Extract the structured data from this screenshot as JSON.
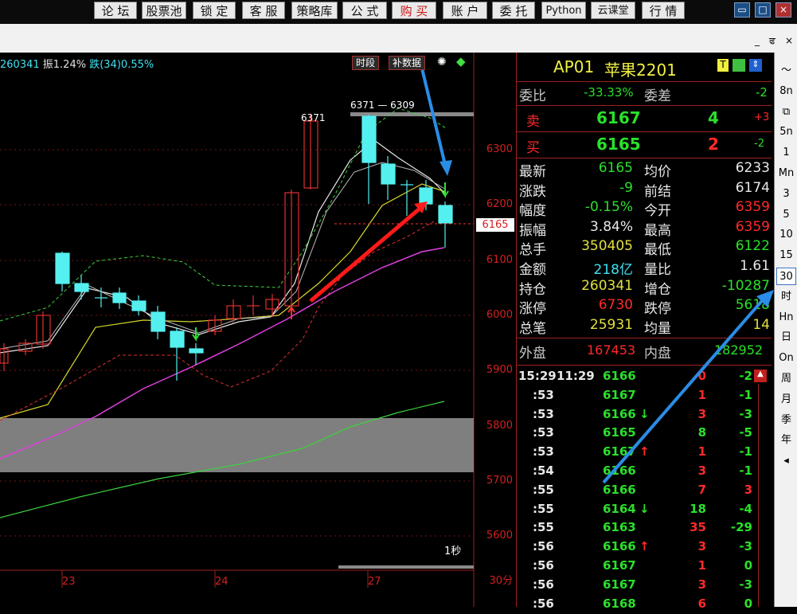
{
  "menu": [
    "论 坛",
    "股票池",
    "锁 定",
    "客 服",
    "策略库",
    "公 式",
    "购 买",
    "账 户",
    "委 托",
    "Python",
    "云课堂",
    "行 情"
  ],
  "window_controls": [
    "▭",
    "□",
    "×"
  ],
  "sub_controls": [
    "_",
    "ਫ",
    "×"
  ],
  "status": {
    "oi": "260341",
    "amp": "振1.24%",
    "fall": "跌(34)0.55%"
  },
  "chart_buttons": {
    "period": "时段",
    "fill": "补数据"
  },
  "yaxis_labels": [
    "6300",
    "6200",
    "6100",
    "6000",
    "5900",
    "5800",
    "5700",
    "5600"
  ],
  "last_price_tag": "6165",
  "xaxis_labels": [
    "23",
    "24",
    "27"
  ],
  "period_label": "30分",
  "refresh_label": "1秒",
  "hi_label": "6371",
  "top_note": "6371 — 6309",
  "quote": {
    "code": "AP01",
    "name": "苹果2201",
    "wb_label": "委比",
    "wb": "-33.33%",
    "wc_label": "委差",
    "wc": "-2",
    "sell_label": "卖",
    "sell_price": "6167",
    "sell_vol": "4",
    "sell_chg": "+3",
    "buy_label": "买",
    "buy_price": "6165",
    "buy_vol": "2",
    "buy_chg": "-2",
    "rows": [
      {
        "l1": "最新",
        "v1": "6165",
        "l2": "均价",
        "v2": "6233"
      },
      {
        "l1": "涨跌",
        "v1": "-9",
        "l2": "前结",
        "v2": "6174"
      },
      {
        "l1": "幅度",
        "v1": "-0.15%",
        "l2": "今开",
        "v2": "6359"
      },
      {
        "l1": "振幅",
        "v1": "3.84%",
        "l2": "最高",
        "v2": "6359"
      },
      {
        "l1": "总手",
        "v1": "350405",
        "l2": "最低",
        "v2": "6122"
      },
      {
        "l1": "金额",
        "v1": "218亿",
        "l2": "量比",
        "v2": "1.61"
      },
      {
        "l1": "持仓",
        "v1": "260341",
        "l2": "增仓",
        "v2": "-10287"
      },
      {
        "l1": "涨停",
        "v1": "6730",
        "l2": "跌停",
        "v2": "5618"
      },
      {
        "l1": "总笔",
        "v1": "25931",
        "l2": "均量",
        "v2": "14"
      }
    ],
    "outer_label": "外盘",
    "outer": "167453",
    "inner_label": "内盘",
    "inner": "182952"
  },
  "ticks": [
    {
      "t": "15:29",
      "t2": "11:29",
      "p": "6166",
      "a": "",
      "v": "0",
      "d": "-2"
    },
    {
      "t": ":53",
      "t2": "",
      "p": "6167",
      "a": "",
      "v": "1",
      "d": "-1"
    },
    {
      "t": ":53",
      "t2": "",
      "p": "6166",
      "a": "↓",
      "v": "3",
      "d": "-3"
    },
    {
      "t": ":53",
      "t2": "",
      "p": "6165",
      "a": "",
      "v": "8",
      "d": "-5"
    },
    {
      "t": ":53",
      "t2": "",
      "p": "6167",
      "a": "↑",
      "v": "1",
      "d": "-1"
    },
    {
      "t": ":54",
      "t2": "",
      "p": "6166",
      "a": "",
      "v": "3",
      "d": "-1"
    },
    {
      "t": ":55",
      "t2": "",
      "p": "6166",
      "a": "",
      "v": "7",
      "d": "3"
    },
    {
      "t": ":55",
      "t2": "",
      "p": "6164",
      "a": "↓",
      "v": "18",
      "d": "-4"
    },
    {
      "t": ":55",
      "t2": "",
      "p": "6163",
      "a": "",
      "v": "35",
      "d": "-29"
    },
    {
      "t": ":56",
      "t2": "",
      "p": "6166",
      "a": "↑",
      "v": "3",
      "d": "-3"
    },
    {
      "t": ":56",
      "t2": "",
      "p": "6167",
      "a": "",
      "v": "1",
      "d": "0"
    },
    {
      "t": ":56",
      "t2": "",
      "p": "6167",
      "a": "",
      "v": "3",
      "d": "-3"
    },
    {
      "t": ":56",
      "t2": "",
      "p": "6168",
      "a": "",
      "v": "6",
      "d": "0"
    }
  ],
  "sidebar": [
    "〜",
    "8n",
    "⧉",
    "5n",
    "1",
    "Mn",
    "3",
    "5",
    "10",
    "15",
    "30",
    "时",
    "Hn",
    "日",
    "On",
    "周",
    "月",
    "季",
    "年",
    "◂"
  ],
  "sidebar_active": "30"
}
